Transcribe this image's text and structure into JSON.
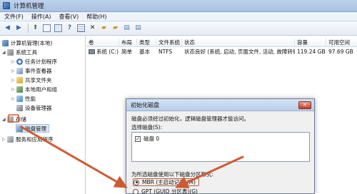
{
  "window": {
    "title": "计算机管理"
  },
  "menu": [
    "文件(F)",
    "操作(A)",
    "查看(V)",
    "帮助(H)"
  ],
  "toolbar": {
    "icons": [
      "back-icon",
      "forward-icon",
      "up-icon",
      "show-hide-tree-icon",
      "properties-icon",
      "help-icon",
      "grid-icon",
      "delete-icon",
      "open-icon",
      "new-icon",
      "refresh-icon",
      "export-icon"
    ]
  },
  "tree": {
    "root": "计算机管理(本地)",
    "system_tools": "系统工具",
    "task_scheduler": "任务计划程序",
    "event_viewer": "事件查看器",
    "shared_folders": "共享文件夹",
    "local_users": "本地用户和组",
    "performance": "性能",
    "device_manager": "设备管理器",
    "storage": "存储",
    "disk_management": "磁盘管理",
    "services": "服务和应用程序"
  },
  "volume_list": {
    "columns": [
      "卷",
      "布局",
      "类型",
      "文件系统",
      "状态",
      "容量",
      "可用空间"
    ],
    "rows": [
      {
        "volume": "系统 (C:)",
        "layout": "简单",
        "type": "基本",
        "fs": "NTFS",
        "status": "状态良好 (系统, 启动, 页面文件, 活动, 故障转储, 主分区)",
        "capacity": "119.24 GB",
        "free": "97.69 GB"
      }
    ]
  },
  "dialog": {
    "title": "初始化磁盘",
    "close": "✕",
    "message": "磁盘必须经过初始化，逻辑磁盘管理器才能访问。",
    "select_label": "选择磁盘(S):",
    "disk_item": "磁盘 0",
    "style_label": "为所选磁盘使用以下磁盘分区形式:",
    "option_mbr": "MBR (主启动记录)(M)",
    "option_gpt": "GPT (GUID 分区表)(G)"
  },
  "colors": {
    "annotation": "#cf5a32",
    "titlebar": "#bcd3ec",
    "selection": "#dbe8f7"
  }
}
